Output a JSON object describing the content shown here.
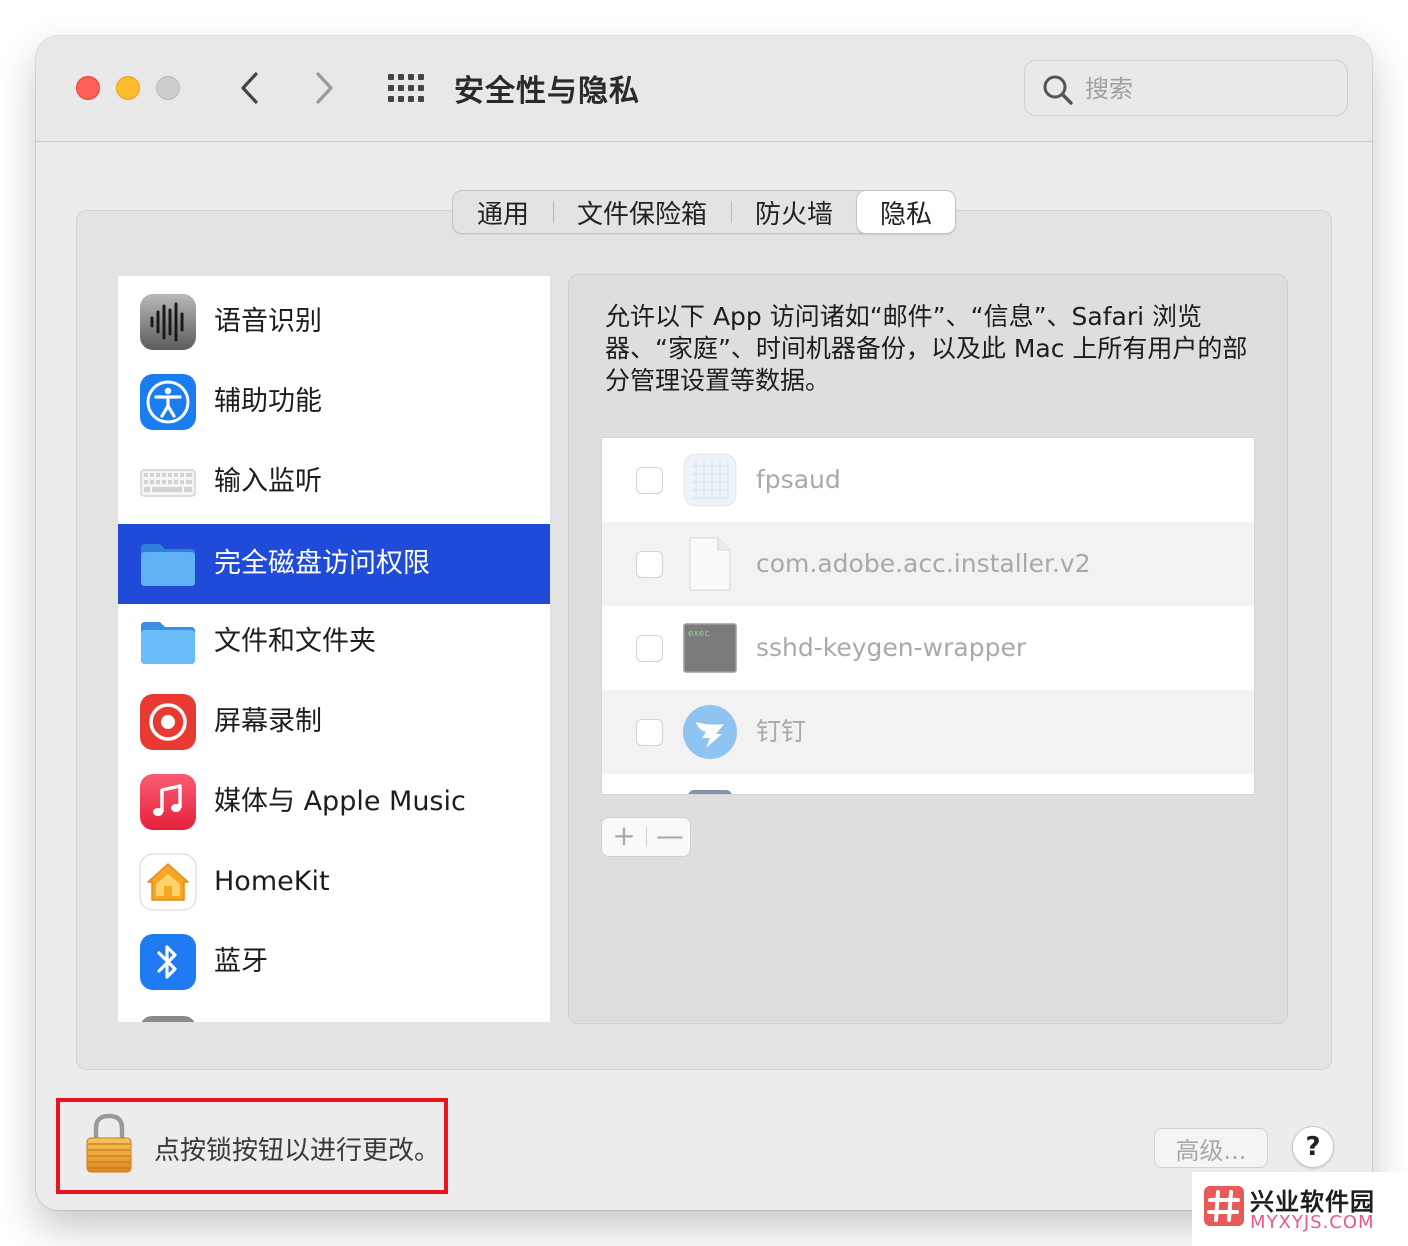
{
  "window": {
    "title": "安全性与隐私",
    "search_placeholder": "搜索"
  },
  "tabs": [
    {
      "label": "通用",
      "selected": false
    },
    {
      "label": "文件保险箱",
      "selected": false
    },
    {
      "label": "防火墙",
      "selected": false
    },
    {
      "label": "隐私",
      "selected": true
    }
  ],
  "sidebar": {
    "items": [
      {
        "label": "语音识别",
        "icon": "speech-recognition-icon",
        "selected": false
      },
      {
        "label": "辅助功能",
        "icon": "accessibility-icon",
        "selected": false
      },
      {
        "label": "输入监听",
        "icon": "keyboard-icon",
        "selected": false
      },
      {
        "label": "完全磁盘访问权限",
        "icon": "folder-icon",
        "selected": true
      },
      {
        "label": "文件和文件夹",
        "icon": "folder-icon",
        "selected": false
      },
      {
        "label": "屏幕录制",
        "icon": "screen-recording-icon",
        "selected": false
      },
      {
        "label": "媒体与 Apple Music",
        "icon": "music-icon",
        "selected": false
      },
      {
        "label": "HomeKit",
        "icon": "home-icon",
        "selected": false
      },
      {
        "label": "蓝牙",
        "icon": "bluetooth-icon",
        "selected": false
      }
    ]
  },
  "main": {
    "description": "允许以下 App 访问诸如“邮件”、“信息”、Safari 浏览器、“家庭”、时间机器备份，以及此 Mac 上所有用户的部分管理设置等数据。",
    "apps": [
      {
        "name": "fpsaud",
        "checked": false,
        "icon": "generic-app-icon"
      },
      {
        "name": "com.adobe.acc.installer.v2",
        "checked": false,
        "icon": "document-icon"
      },
      {
        "name": "sshd-keygen-wrapper",
        "checked": false,
        "icon": "exec-icon",
        "icon_text": "exec"
      },
      {
        "name": "钉钉",
        "checked": false,
        "icon": "dingtalk-icon"
      }
    ],
    "add_label": "+",
    "remove_label": "—"
  },
  "footer": {
    "lock_text": "点按锁按钮以进行更改。",
    "advanced_label": "高级...",
    "help_label": "?"
  },
  "watermark": {
    "name": "兴业软件园",
    "site": "MYXYJS.COM"
  },
  "colors": {
    "selection": "#1f4bd8",
    "highlight_box": "#e8141f"
  }
}
